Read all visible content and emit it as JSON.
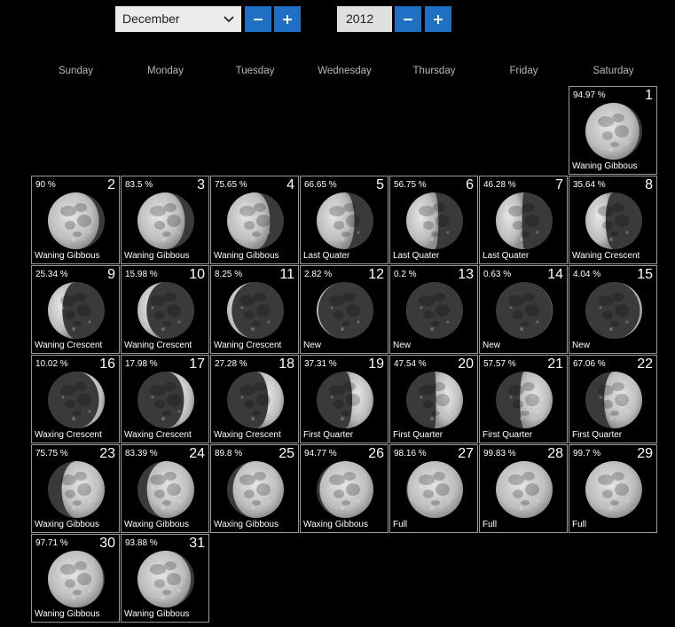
{
  "month_selector": {
    "value": "December"
  },
  "year_selector": {
    "value": "2012"
  },
  "buttons": {
    "minus": "−",
    "plus": "+"
  },
  "weekdays": [
    "Sunday",
    "Monday",
    "Tuesday",
    "Wednesday",
    "Thursday",
    "Friday",
    "Saturday"
  ],
  "first_weekday_index": 6,
  "days": [
    {
      "day": "1",
      "percent": "94.97 %",
      "phase": "Waning Gibbous",
      "illum": 0.9497,
      "waxing": false
    },
    {
      "day": "2",
      "percent": "90 %",
      "phase": "Waning Gibbous",
      "illum": 0.9,
      "waxing": false
    },
    {
      "day": "3",
      "percent": "83.5 %",
      "phase": "Waning Gibbous",
      "illum": 0.835,
      "waxing": false
    },
    {
      "day": "4",
      "percent": "75.65 %",
      "phase": "Waning Gibbous",
      "illum": 0.7565,
      "waxing": false
    },
    {
      "day": "5",
      "percent": "66.65 %",
      "phase": "Last Quater",
      "illum": 0.6665,
      "waxing": false
    },
    {
      "day": "6",
      "percent": "56.75 %",
      "phase": "Last Quater",
      "illum": 0.5675,
      "waxing": false
    },
    {
      "day": "7",
      "percent": "46.28 %",
      "phase": "Last Quater",
      "illum": 0.4628,
      "waxing": false
    },
    {
      "day": "8",
      "percent": "35.64 %",
      "phase": "Waning Crescent",
      "illum": 0.3564,
      "waxing": false
    },
    {
      "day": "9",
      "percent": "25.34 %",
      "phase": "Waning Crescent",
      "illum": 0.2534,
      "waxing": false
    },
    {
      "day": "10",
      "percent": "15.98 %",
      "phase": "Waning Crescent",
      "illum": 0.1598,
      "waxing": false
    },
    {
      "day": "11",
      "percent": "8.25 %",
      "phase": "Waning Crescent",
      "illum": 0.0825,
      "waxing": false
    },
    {
      "day": "12",
      "percent": "2.82 %",
      "phase": "New",
      "illum": 0.0282,
      "waxing": false
    },
    {
      "day": "13",
      "percent": "0.2 %",
      "phase": "New",
      "illum": 0.002,
      "waxing": false
    },
    {
      "day": "14",
      "percent": "0.63 %",
      "phase": "New",
      "illum": 0.0063,
      "waxing": true
    },
    {
      "day": "15",
      "percent": "4.04 %",
      "phase": "New",
      "illum": 0.0404,
      "waxing": true
    },
    {
      "day": "16",
      "percent": "10.02 %",
      "phase": "Waxing Crescent",
      "illum": 0.1002,
      "waxing": true
    },
    {
      "day": "17",
      "percent": "17.98 %",
      "phase": "Waxing Crescent",
      "illum": 0.1798,
      "waxing": true
    },
    {
      "day": "18",
      "percent": "27.28 %",
      "phase": "Waxing Crescent",
      "illum": 0.2728,
      "waxing": true
    },
    {
      "day": "19",
      "percent": "37.31 %",
      "phase": "First Quarter",
      "illum": 0.3731,
      "waxing": true
    },
    {
      "day": "20",
      "percent": "47.54 %",
      "phase": "First Quarter",
      "illum": 0.4754,
      "waxing": true
    },
    {
      "day": "21",
      "percent": "57.57 %",
      "phase": "First Quarter",
      "illum": 0.5757,
      "waxing": true
    },
    {
      "day": "22",
      "percent": "67.06 %",
      "phase": "First Quarter",
      "illum": 0.6706,
      "waxing": true
    },
    {
      "day": "23",
      "percent": "75.75 %",
      "phase": "Waxing Gibbous",
      "illum": 0.7575,
      "waxing": true
    },
    {
      "day": "24",
      "percent": "83.39 %",
      "phase": "Waxing Gibbous",
      "illum": 0.8339,
      "waxing": true
    },
    {
      "day": "25",
      "percent": "89.8 %",
      "phase": "Waxing Gibbous",
      "illum": 0.898,
      "waxing": true
    },
    {
      "day": "26",
      "percent": "94.77 %",
      "phase": "Waxing Gibbous",
      "illum": 0.9477,
      "waxing": true
    },
    {
      "day": "27",
      "percent": "98.16 %",
      "phase": "Full",
      "illum": 0.9816,
      "waxing": true
    },
    {
      "day": "28",
      "percent": "99.83 %",
      "phase": "Full",
      "illum": 0.9983,
      "waxing": true
    },
    {
      "day": "29",
      "percent": "99.7 %",
      "phase": "Full",
      "illum": 0.997,
      "waxing": false
    },
    {
      "day": "30",
      "percent": "97.71 %",
      "phase": "Waning Gibbous",
      "illum": 0.9771,
      "waxing": false
    },
    {
      "day": "31",
      "percent": "93.88 %",
      "phase": "Waning Gibbous",
      "illum": 0.9388,
      "waxing": false
    }
  ]
}
